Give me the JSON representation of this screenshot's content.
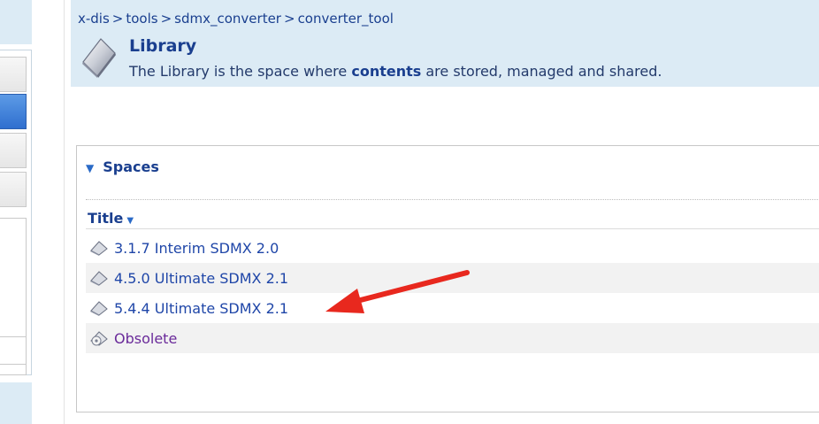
{
  "breadcrumb": [
    {
      "label": "x-dis"
    },
    {
      "label": "tools"
    },
    {
      "label": "sdmx_converter"
    },
    {
      "label": "converter_tool"
    }
  ],
  "breadcrumb_separator": ">",
  "header": {
    "title": "Library",
    "description_before": "The Library is the space where ",
    "description_bold": "contents",
    "description_after": " are stored, managed and shared."
  },
  "spaces": {
    "heading": "Spaces",
    "column_title": "Title",
    "items": [
      {
        "label": "3.1.7 Interim SDMX 2.0",
        "icon": "space-icon"
      },
      {
        "label": "4.5.0 Ultimate SDMX 2.1",
        "icon": "space-icon"
      },
      {
        "label": "5.4.4 Ultimate SDMX 2.1",
        "icon": "space-icon"
      },
      {
        "label": "Obsolete",
        "icon": "archived-space-icon"
      }
    ]
  },
  "colors": {
    "header_bg": "#dcebf5",
    "link": "#1f46a8",
    "visited_link": "#6a2a9a",
    "annotation_arrow": "#e8281e"
  }
}
